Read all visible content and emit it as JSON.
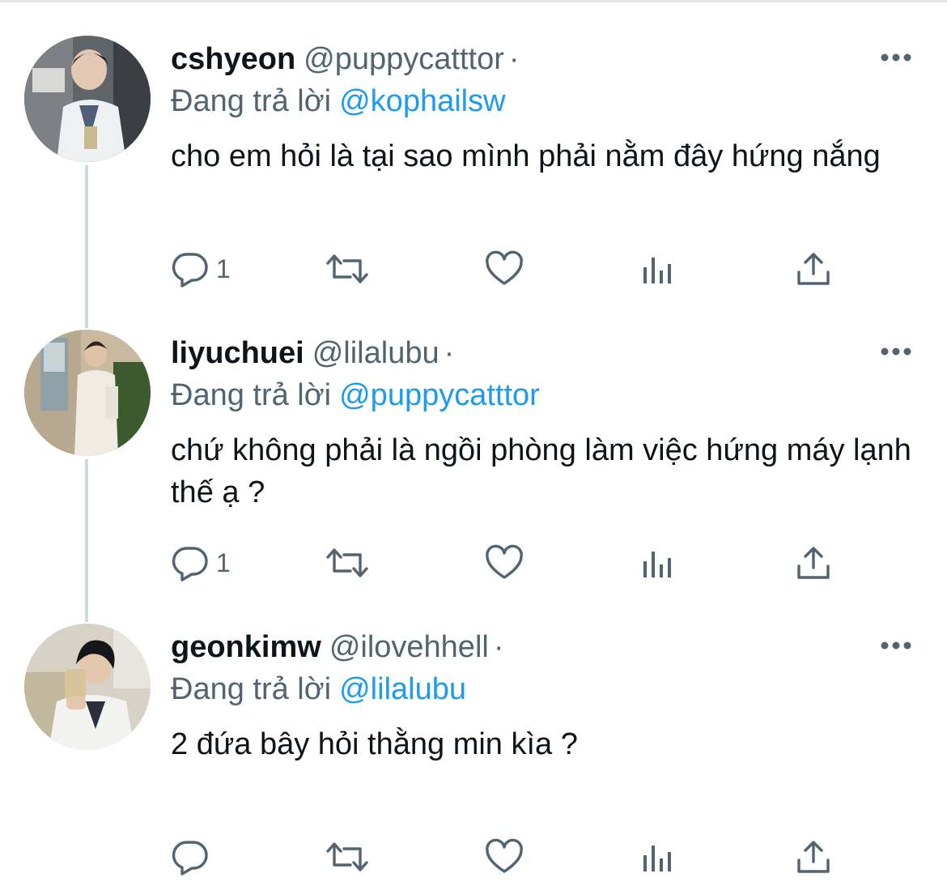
{
  "reply_prefix": "Đang trả lời",
  "colors": {
    "accent": "#1d9bf0",
    "text": "#0f1419",
    "muted": "#536471",
    "thread_line": "#cfd9de"
  },
  "tweets": [
    {
      "name": "cshyeon",
      "handle": "@puppycatttor",
      "dot": "·",
      "reply_to": "@kophailsw",
      "text": "cho em hỏi là tại sao mình phải nằm đây hứng nắng",
      "reply_count": "1",
      "retweet_count": "",
      "like_count": ""
    },
    {
      "name": "liyuchuei",
      "handle": "@lilalubu",
      "dot": "·",
      "reply_to": "@puppycatttor",
      "text": "chứ không phải là ngồi phòng làm việc hứng máy lạnh thế ạ ?",
      "reply_count": "1",
      "retweet_count": "",
      "like_count": ""
    },
    {
      "name": "geonkimw",
      "handle": "@ilovehhell",
      "dot": "·",
      "reply_to": "@lilalubu",
      "text": "2 đứa bây hỏi thằng min kìa ?",
      "reply_count": "",
      "retweet_count": "",
      "like_count": ""
    }
  ],
  "icons": {
    "reply": "reply-bubble-icon",
    "retweet": "retweet-icon",
    "like": "heart-icon",
    "analytics": "analytics-bars-icon",
    "share": "share-upload-icon",
    "more": "more-dots-icon"
  }
}
